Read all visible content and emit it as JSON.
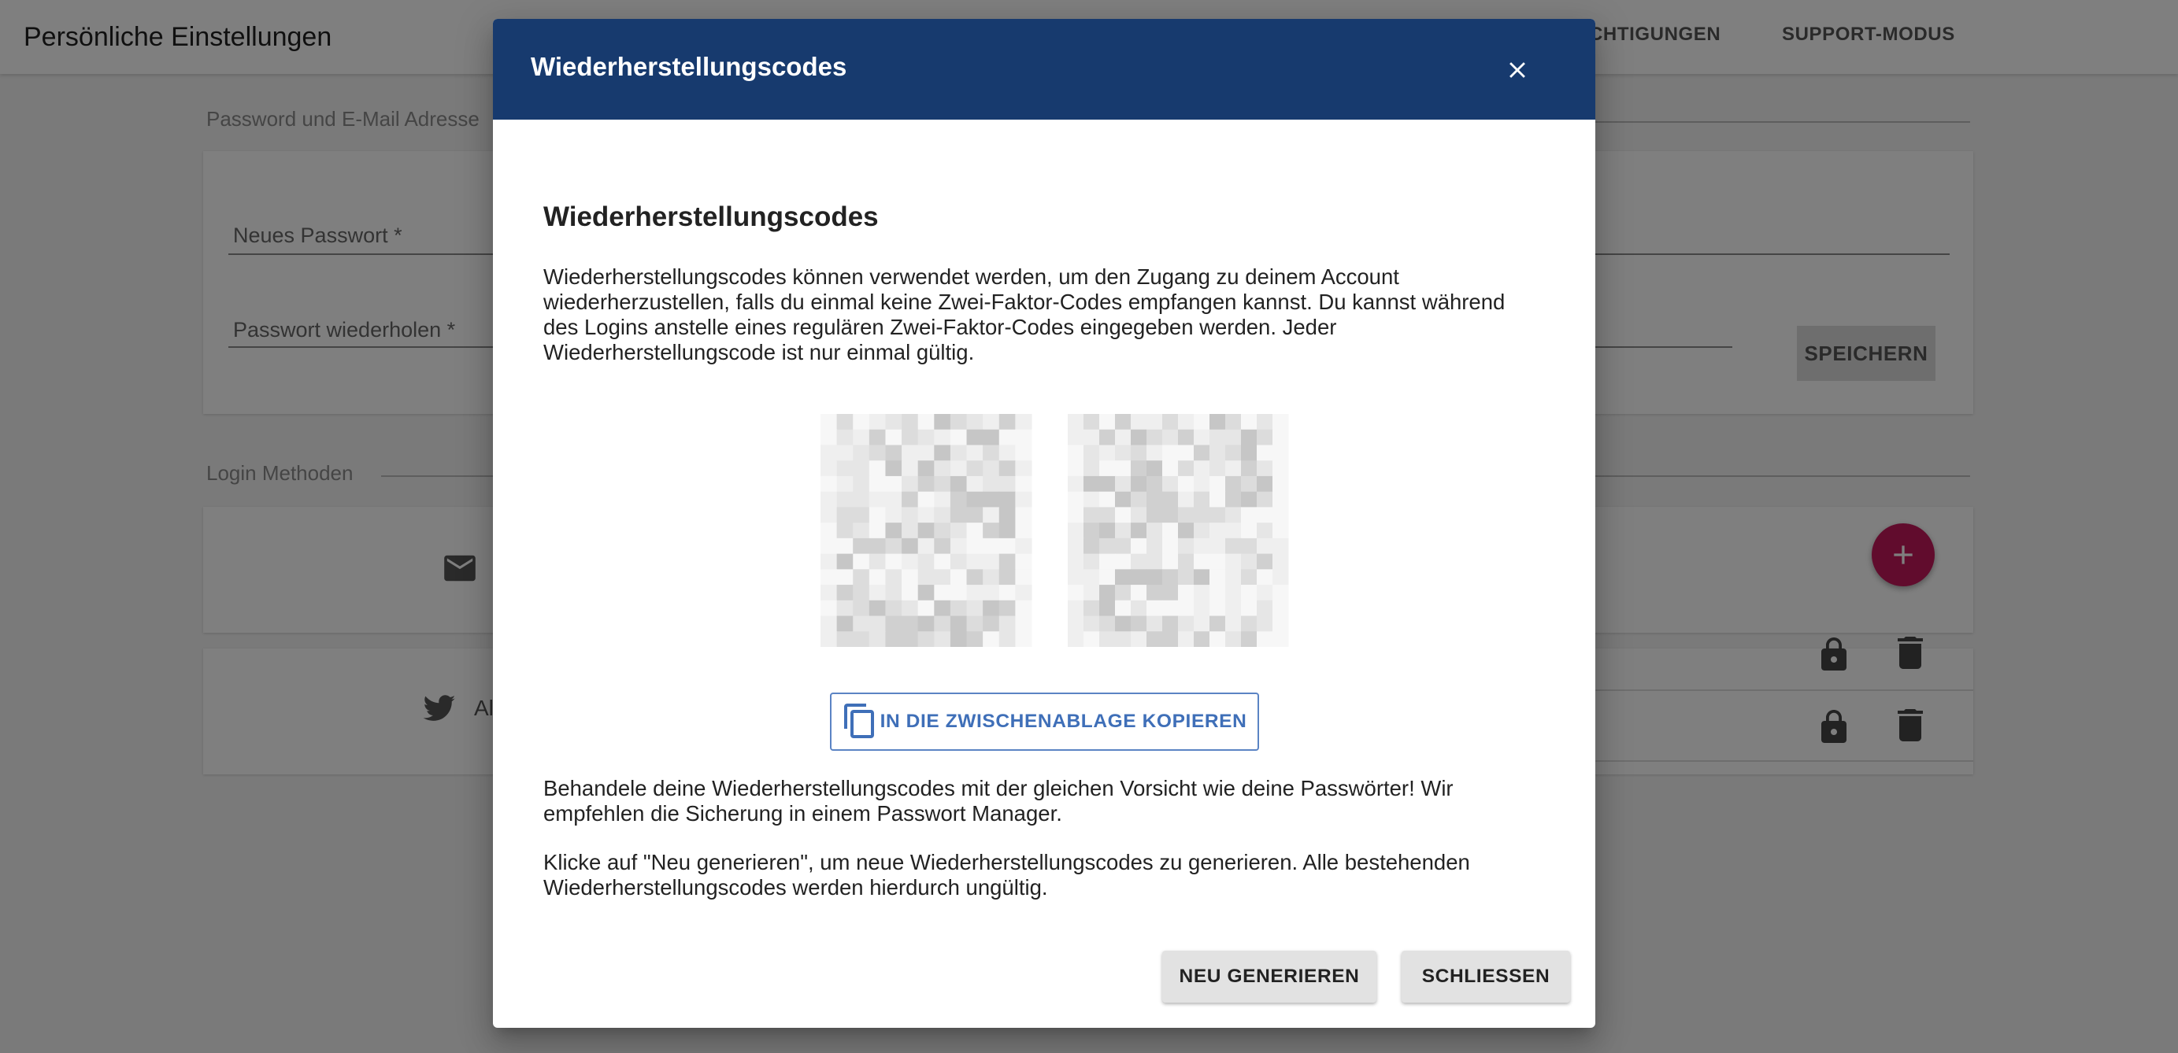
{
  "app": {
    "title": "Persönliche Einstellungen",
    "nav_tabs": [
      "CHTIGUNGEN",
      "SUPPORT-MODUS"
    ]
  },
  "password_section": {
    "label": "Password und E-Mail Adresse",
    "new_password_label": "Neues Passwort *",
    "repeat_password_label": "Passwort wiederholen *",
    "save_label": "SPEICHERN"
  },
  "login_section": {
    "label": "Login Methoden",
    "twitter_partial_text": "Al"
  },
  "dialog": {
    "title": "Wiederherstellungscodes",
    "heading": "Wiederherstellungscodes",
    "intro_lines": [
      "Wiederherstellungscodes können verwendet werden, um den Zugang zu deinem Account",
      "wiederherzustellen, falls du einmal keine Zwei-Faktor-Codes empfangen kannst. Du kannst während",
      "des Logins anstelle eines regulären Zwei-Faktor-Codes eingegeben werden. Jeder",
      "Wiederherstellungscode ist nur einmal gültig."
    ],
    "copy_label": "IN DIE ZWISCHENABLAGE KOPIEREN",
    "warning_lines": [
      "Behandele deine Wiederherstellungscodes mit der gleichen Vorsicht wie deine Passwörter! Wir",
      "empfehlen die Sicherung in einem Passwort Manager."
    ],
    "regenerate_lines": [
      "Klicke auf \"Neu generieren\", um neue Wiederherstellungscodes zu generieren. Alle bestehenden",
      "Wiederherstellungscodes werden hierdurch ungültig."
    ],
    "regenerate_label": "NEU GENERIEREN",
    "close_label": "SCHLIESSEN"
  },
  "colors": {
    "header": "#173a6e",
    "accent": "#3f6fb8",
    "fab": "#c2185b"
  },
  "icons": {
    "close": "close-icon",
    "copy": "copy-icon",
    "mail": "mail-icon",
    "twitter": "twitter-icon",
    "lock": "lock-icon",
    "delete": "trash-icon",
    "add": "plus-icon"
  }
}
